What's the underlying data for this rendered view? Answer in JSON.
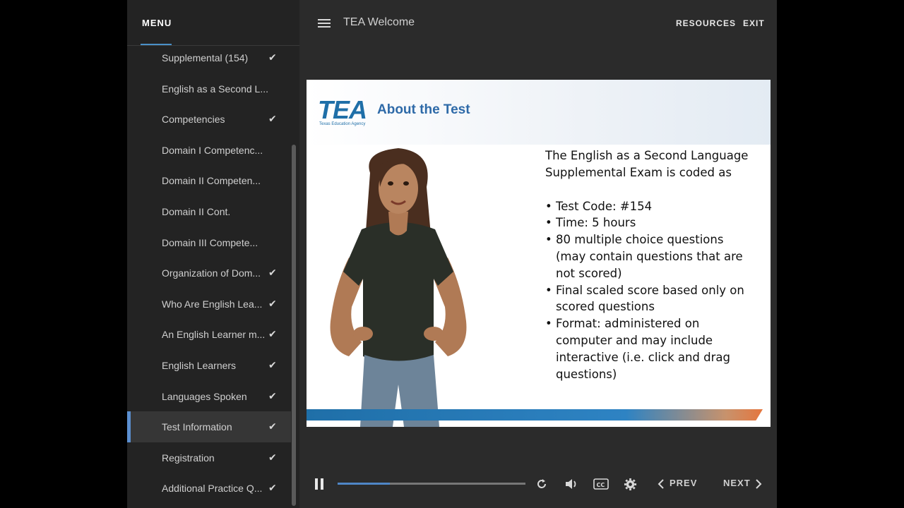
{
  "sidebar": {
    "menu_label": "MENU",
    "items": [
      {
        "label": "Supplemental (154)",
        "checked": true
      },
      {
        "label": "English as a Second L...",
        "checked": false
      },
      {
        "label": "Competencies",
        "checked": true
      },
      {
        "label": "Domain I Competenc...",
        "checked": false
      },
      {
        "label": "Domain II Competen...",
        "checked": false
      },
      {
        "label": "Domain II Cont.",
        "checked": false
      },
      {
        "label": "Domain III Compete...",
        "checked": false
      },
      {
        "label": "Organization of Dom...",
        "checked": true
      },
      {
        "label": "Who Are English Lea...",
        "checked": true
      },
      {
        "label": "An English Learner m...",
        "checked": true
      },
      {
        "label": "English Learners",
        "checked": true
      },
      {
        "label": "Languages Spoken",
        "checked": true
      },
      {
        "label": "Test Information",
        "checked": true,
        "active": true
      },
      {
        "label": "Registration",
        "checked": true
      },
      {
        "label": "Additional Practice Q...",
        "checked": true
      }
    ],
    "check_glyph": "✔"
  },
  "header": {
    "course_title": "TEA Welcome",
    "resources_label": "RESOURCES",
    "exit_label": "EXIT"
  },
  "slide": {
    "logo_text": "TEA",
    "logo_subtext": "Texas Education Agency",
    "title": "About the Test",
    "intro": "The English as a Second Language Supplemental Exam is coded as",
    "bullets": [
      "Test Code: #154",
      "Time: 5 hours",
      "80 multiple choice questions (may contain questions that are not scored)",
      "Final scaled score based only on scored questions",
      "Format: administered on computer and may include interactive (i.e. click and drag questions)"
    ]
  },
  "controls": {
    "progress_percent": 28,
    "prev_label": "PREV",
    "next_label": "NEXT",
    "icons": [
      "pause-icon",
      "replay-icon",
      "volume-icon",
      "closed-captions-icon",
      "settings-icon",
      "chevron-left-icon",
      "chevron-right-icon"
    ]
  },
  "colors": {
    "accent": "#4f86c6",
    "sidebar_bg": "#232323",
    "main_bg": "#2b2b2b",
    "tea_blue": "#1f6fa8"
  }
}
